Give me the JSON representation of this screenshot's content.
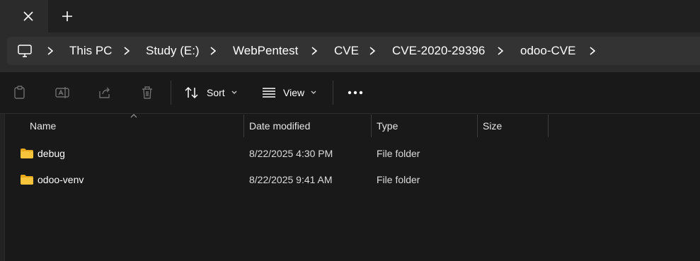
{
  "tabs": {
    "close_icon": "close-icon",
    "new_tab_icon": "plus-icon"
  },
  "breadcrumb": {
    "icon": "this-pc-icon",
    "items": [
      "This PC",
      "Study (E:)",
      "WebPentest",
      "CVE",
      "CVE-2020-29396",
      "odoo-CVE"
    ]
  },
  "toolbar": {
    "sort_label": "Sort",
    "view_label": "View",
    "icons": [
      "copy-icon",
      "rename-icon",
      "share-icon",
      "delete-icon",
      "more-icon"
    ]
  },
  "columns": [
    "Name",
    "Date modified",
    "Type",
    "Size"
  ],
  "files": [
    {
      "name": "debug",
      "date": "8/22/2025 4:30 PM",
      "type": "File folder",
      "size": ""
    },
    {
      "name": "odoo-venv",
      "date": "8/22/2025 9:41 AM",
      "type": "File folder",
      "size": ""
    }
  ],
  "colors": {
    "folder": "#f8c43c",
    "background": "#191919",
    "address_bar": "#333333"
  }
}
